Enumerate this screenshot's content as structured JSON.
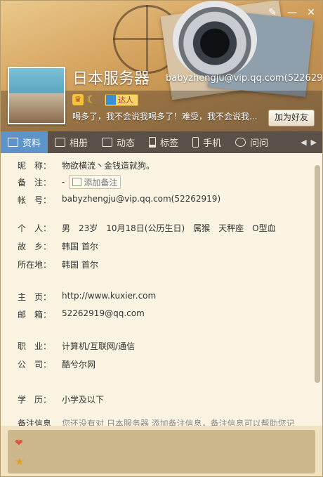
{
  "window": {
    "controls": {
      "skin": "✎",
      "minimize": "—",
      "close": "✕"
    }
  },
  "profile": {
    "nickname": "日本服务器",
    "account": "babyzhengju@vip.qq.com(52262919)",
    "signature": "喝多了，我不会说我喝多了！难受，我不会说我...",
    "talent_label": "达人",
    "add_friend_label": "加为好友"
  },
  "tabs": [
    {
      "label": "资料",
      "icon": "profile-card-icon"
    },
    {
      "label": "相册",
      "icon": "album-icon"
    },
    {
      "label": "动态",
      "icon": "feed-icon"
    },
    {
      "label": "标签",
      "icon": "tag-icon"
    },
    {
      "label": "手机",
      "icon": "phone-icon"
    },
    {
      "label": "问问",
      "icon": "chat-icon"
    }
  ],
  "info": {
    "nickname_label": "昵　称：",
    "nickname_value": "物欲横流丶金钱造就狗。",
    "remark_label": "备　注：",
    "remark_value": "-",
    "add_remark_label": "添加备注",
    "account_label": "帐　号：",
    "account_value": "babyzhengju@vip.qq.com(52262919)",
    "personal_label": "个　人：",
    "personal_value": "男　23岁　10月18日(公历生日)　属猴　天秤座　O型血",
    "hometown_label": "故　乡：",
    "hometown_value": "韩国 首尔",
    "location_label": "所在地：",
    "location_value": "韩国 首尔",
    "homepage_label": "主　页：",
    "homepage_value": "http://www.kuxier.com",
    "email_label": "邮　箱：",
    "email_value": "52262919@qq.com",
    "job_label": "职　业：",
    "job_value": "计算机/互联网/通信",
    "company_label": "公　司：",
    "company_value": "酷兮尔网",
    "education_label": "学　历：",
    "education_value": "小学及以下",
    "remark_info_label": "备注信息",
    "remark_info_value": "您还没有对 日本服务器 添加备注信息，备注信息可以帮助您记"
  }
}
